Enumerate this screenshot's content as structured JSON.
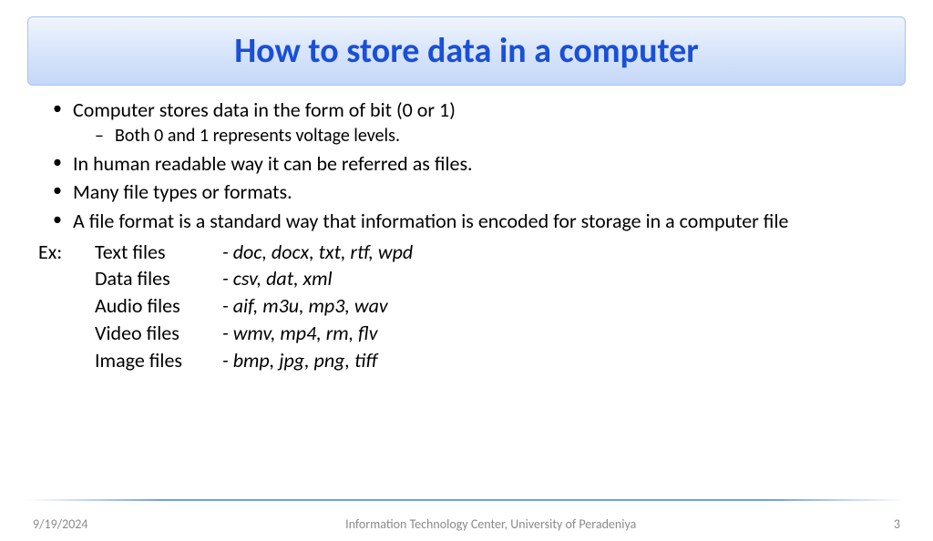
{
  "title": "How to store data in a computer",
  "bullets": {
    "b1": "Computer stores data in the form of bit (0 or 1)",
    "b1_sub": "Both 0 and 1 represents voltage levels.",
    "b2": "In human readable way it can be referred as files.",
    "b3": "Many file types or formats.",
    "b4": "A file format is a standard way that information is encoded for storage in a computer file"
  },
  "examples": {
    "prefix": "Ex:",
    "rows": [
      {
        "label": "Text files",
        "formats": "- doc, docx, txt, rtf, wpd"
      },
      {
        "label": "Data files",
        "formats": "- csv, dat,  xml"
      },
      {
        "label": "Audio files",
        "formats": "- aif, m3u, mp3, wav"
      },
      {
        "label": "Video files",
        "formats": "- wmv, mp4, rm, flv"
      },
      {
        "label": "Image files",
        "formats": "- bmp, jpg, png, tiff"
      }
    ]
  },
  "footer": {
    "date": "9/19/2024",
    "center": "Information Technology Center, University of Peradeniya",
    "page": "3"
  }
}
